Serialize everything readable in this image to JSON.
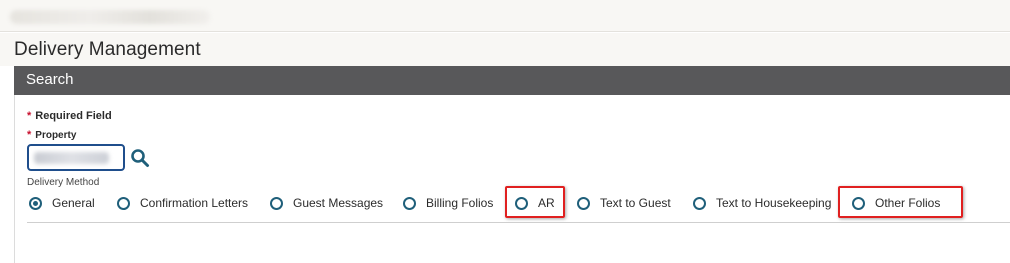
{
  "page": {
    "title": "Delivery Management"
  },
  "search_panel": {
    "title": "Search",
    "required_note": "Required Field",
    "required_marker": "*",
    "property_label": "Property",
    "property_value": "",
    "delivery_method_label": "Delivery Method"
  },
  "delivery_methods": [
    {
      "label": "General",
      "selected": true,
      "highlighted": false
    },
    {
      "label": "Confirmation Letters",
      "selected": false,
      "highlighted": false
    },
    {
      "label": "Guest Messages",
      "selected": false,
      "highlighted": false
    },
    {
      "label": "Billing Folios",
      "selected": false,
      "highlighted": false
    },
    {
      "label": "AR",
      "selected": false,
      "highlighted": true
    },
    {
      "label": "Text to Guest",
      "selected": false,
      "highlighted": false
    },
    {
      "label": "Text to Housekeeping",
      "selected": false,
      "highlighted": false
    },
    {
      "label": "Other Folios",
      "selected": false,
      "highlighted": true
    }
  ],
  "icons": {
    "property_search": "search-icon"
  },
  "colors": {
    "header_bar": "#58585a",
    "accent": "#1f5f7a",
    "input_border": "#1f4e8c",
    "required": "#c8102e",
    "highlight": "#e02020"
  }
}
